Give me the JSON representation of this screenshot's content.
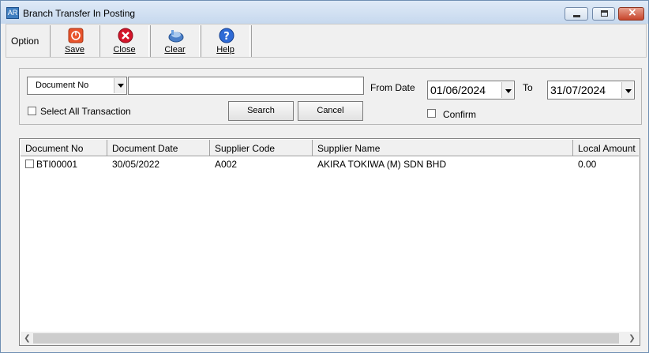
{
  "window": {
    "icon_text": "AR",
    "title": "Branch Transfer In Posting"
  },
  "toolbar": {
    "option_label": "Option",
    "buttons": [
      {
        "label": "Save",
        "icon": "save-icon"
      },
      {
        "label": "Close",
        "icon": "close-icon"
      },
      {
        "label": "Clear",
        "icon": "clear-icon"
      },
      {
        "label": "Help",
        "icon": "help-icon"
      }
    ]
  },
  "search": {
    "field_select": "Document No",
    "search_text": "",
    "select_all_label": "Select All Transaction",
    "search_button": "Search",
    "cancel_button": "Cancel",
    "from_date_label": "From Date",
    "from_date": "01/06/2024",
    "to_label": "To",
    "to_date": "31/07/2024",
    "confirm_label": "Confirm"
  },
  "grid": {
    "columns": [
      "Document No",
      "Document Date",
      "Supplier Code",
      "Supplier Name",
      "Local Amount"
    ],
    "rows": [
      {
        "document_no": "BTI00001",
        "document_date": "30/05/2022",
        "supplier_code": "A002",
        "supplier_name": "AKIRA TOKIWA (M) SDN BHD",
        "local_amount": "0.00"
      }
    ]
  },
  "colors": {
    "title_bar": "#c6d8ee",
    "close_button": "#c7452b",
    "window_bg": "#f0f0f0"
  }
}
